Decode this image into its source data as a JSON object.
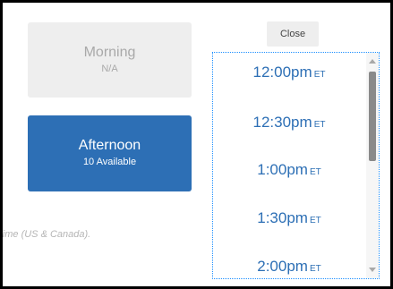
{
  "left_panel": {
    "morning": {
      "label": "Morning",
      "availability": "N/A"
    },
    "afternoon": {
      "label": "Afternoon",
      "availability": "10 Available"
    },
    "timezone_note": "n Time (US & Canada)."
  },
  "right_panel": {
    "close_label": "Close",
    "time_options": [
      {
        "time": "12:00pm",
        "zone": "ET"
      },
      {
        "time": "12:30pm",
        "zone": "ET"
      },
      {
        "time": "1:00pm",
        "zone": "ET"
      },
      {
        "time": "1:30pm",
        "zone": "ET"
      },
      {
        "time": "2:00pm",
        "zone": "ET"
      }
    ]
  },
  "colors": {
    "accent_blue": "#2d6fb5",
    "disabled_gray": "#eeeeee",
    "focus_outline": "#1e90ff"
  }
}
